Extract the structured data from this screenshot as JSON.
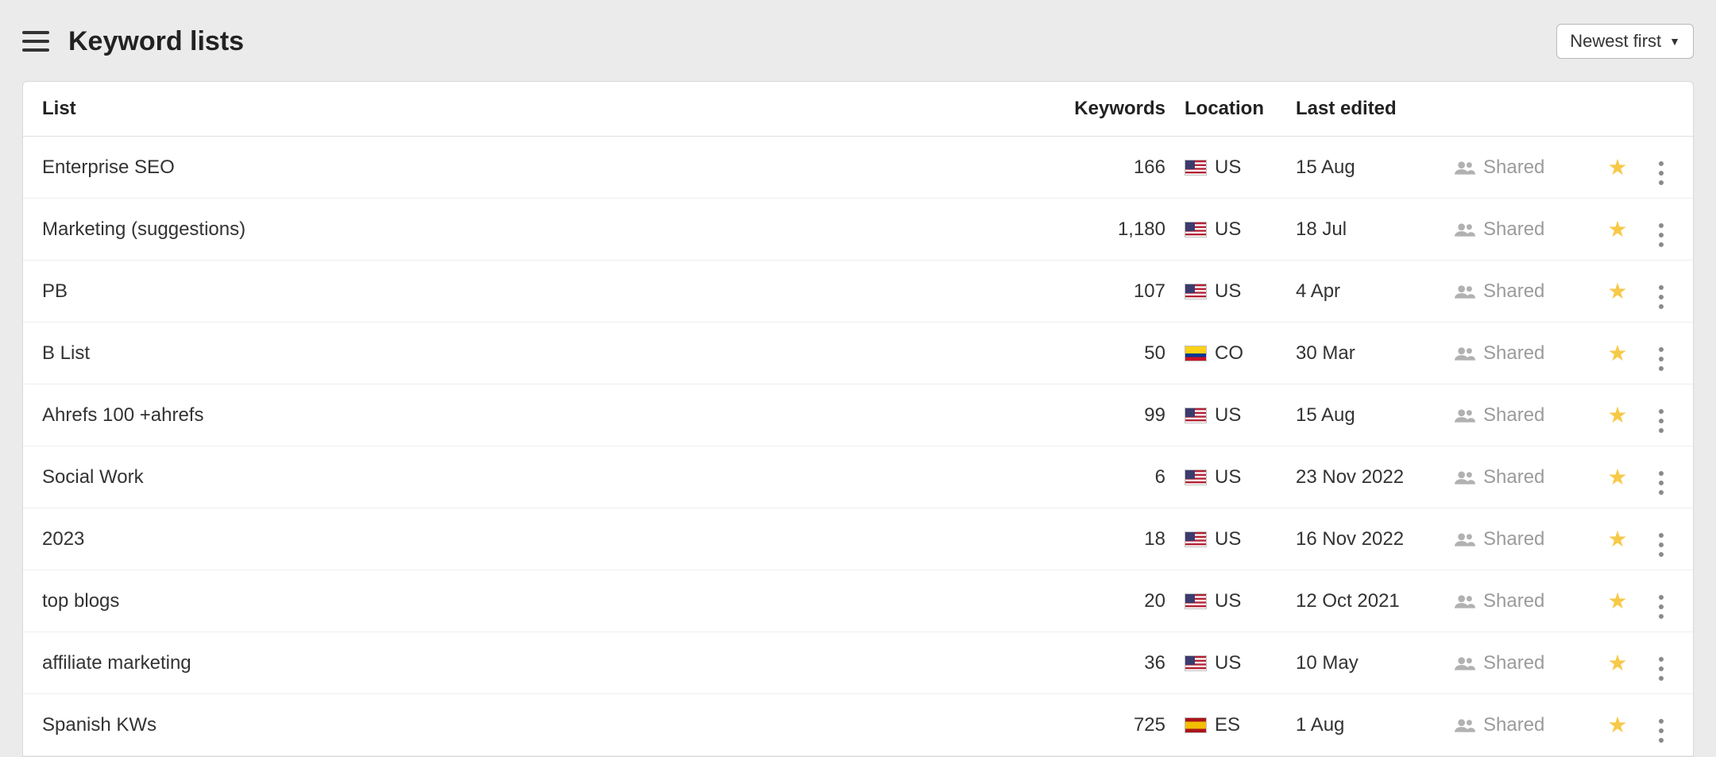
{
  "header": {
    "title": "Keyword lists",
    "sort_label": "Newest first"
  },
  "columns": {
    "list": "List",
    "keywords": "Keywords",
    "location": "Location",
    "last_edited": "Last edited"
  },
  "shared_label": "Shared",
  "rows": [
    {
      "name": "Enterprise SEO",
      "keywords": "166",
      "flag": "us",
      "country": "US",
      "last_edited": "15 Aug"
    },
    {
      "name": "Marketing (suggestions)",
      "keywords": "1,180",
      "flag": "us",
      "country": "US",
      "last_edited": "18 Jul"
    },
    {
      "name": "PB",
      "keywords": "107",
      "flag": "us",
      "country": "US",
      "last_edited": "4 Apr"
    },
    {
      "name": "B List",
      "keywords": "50",
      "flag": "co",
      "country": "CO",
      "last_edited": "30 Mar"
    },
    {
      "name": "Ahrefs 100 +ahrefs",
      "keywords": "99",
      "flag": "us",
      "country": "US",
      "last_edited": "15 Aug"
    },
    {
      "name": "Social Work",
      "keywords": "6",
      "flag": "us",
      "country": "US",
      "last_edited": "23 Nov 2022"
    },
    {
      "name": "2023",
      "keywords": "18",
      "flag": "us",
      "country": "US",
      "last_edited": "16 Nov 2022"
    },
    {
      "name": "top blogs",
      "keywords": "20",
      "flag": "us",
      "country": "US",
      "last_edited": "12 Oct 2021"
    },
    {
      "name": "affiliate marketing",
      "keywords": "36",
      "flag": "us",
      "country": "US",
      "last_edited": "10 May"
    },
    {
      "name": "Spanish KWs",
      "keywords": "725",
      "flag": "es",
      "country": "ES",
      "last_edited": "1 Aug"
    }
  ]
}
